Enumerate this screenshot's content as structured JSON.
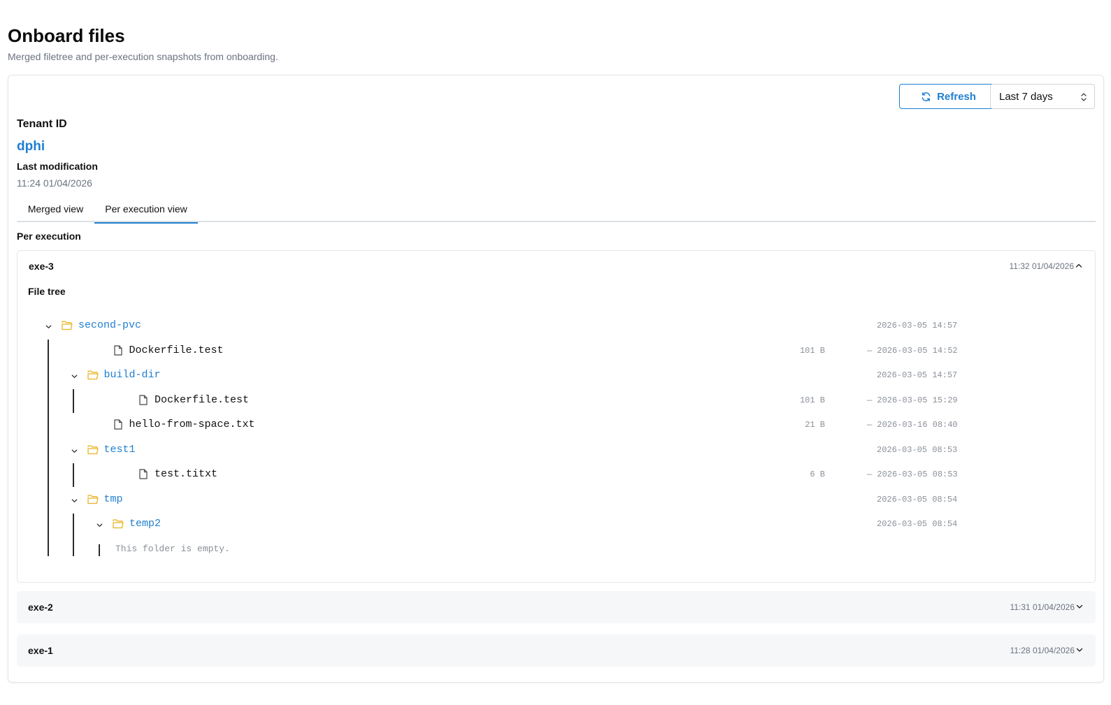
{
  "page": {
    "title": "Onboard files",
    "subtitle": "Merged filetree and per-execution snapshots from onboarding."
  },
  "toolbar": {
    "refresh_label": "Refresh",
    "range_value": "Last 7 days"
  },
  "tenant": {
    "label": "Tenant ID",
    "value": "dphi",
    "last_mod_label": "Last modification",
    "last_mod_value": "11:24 01/04/2026"
  },
  "tabs": [
    {
      "label": "Merged view",
      "active": false
    },
    {
      "label": "Per execution view",
      "active": true
    }
  ],
  "section_label": "Per execution",
  "executions": [
    {
      "name": "exe-3",
      "time": "11:32 01/04/2026",
      "expanded": true,
      "filetree_label": "File tree",
      "tree": [
        {
          "type": "folder",
          "name": "second-pvc",
          "depth": 0,
          "date": "2026-03-05 14:57"
        },
        {
          "type": "file",
          "name": "Dockerfile.test",
          "depth": 1,
          "size": "101 B",
          "date": "— 2026-03-05 14:52"
        },
        {
          "type": "folder",
          "name": "build-dir",
          "depth": 1,
          "date": "2026-03-05 14:57"
        },
        {
          "type": "file",
          "name": "Dockerfile.test",
          "depth": 2,
          "size": "101 B",
          "date": "— 2026-03-05 15:29"
        },
        {
          "type": "file",
          "name": "hello-from-space.txt",
          "depth": 1,
          "size": "21 B",
          "date": "— 2026-03-16 08:40"
        },
        {
          "type": "folder",
          "name": "test1",
          "depth": 1,
          "date": "2026-03-05 08:53"
        },
        {
          "type": "file",
          "name": "test.titxt",
          "depth": 2,
          "size": "6 B",
          "date": "— 2026-03-05 08:53"
        },
        {
          "type": "folder",
          "name": "tmp",
          "depth": 1,
          "date": "2026-03-05 08:54"
        },
        {
          "type": "folder",
          "name": "temp2",
          "depth": 2,
          "date": "2026-03-05 08:54"
        },
        {
          "type": "empty",
          "name": "This folder is empty.",
          "depth": 3
        }
      ]
    },
    {
      "name": "exe-2",
      "time": "11:31 01/04/2026",
      "expanded": false
    },
    {
      "name": "exe-1",
      "time": "11:28 01/04/2026",
      "expanded": false
    }
  ],
  "colors": {
    "accent": "#1f7fd0",
    "folder": "#e8b320",
    "muted": "#6b7280"
  },
  "icons": {
    "refresh": "refresh-icon",
    "folder": "folder-open-icon",
    "file": "file-icon",
    "chevron_down": "chevron-down-icon",
    "chevron_up": "chevron-up-icon",
    "select": "updown-icon"
  }
}
